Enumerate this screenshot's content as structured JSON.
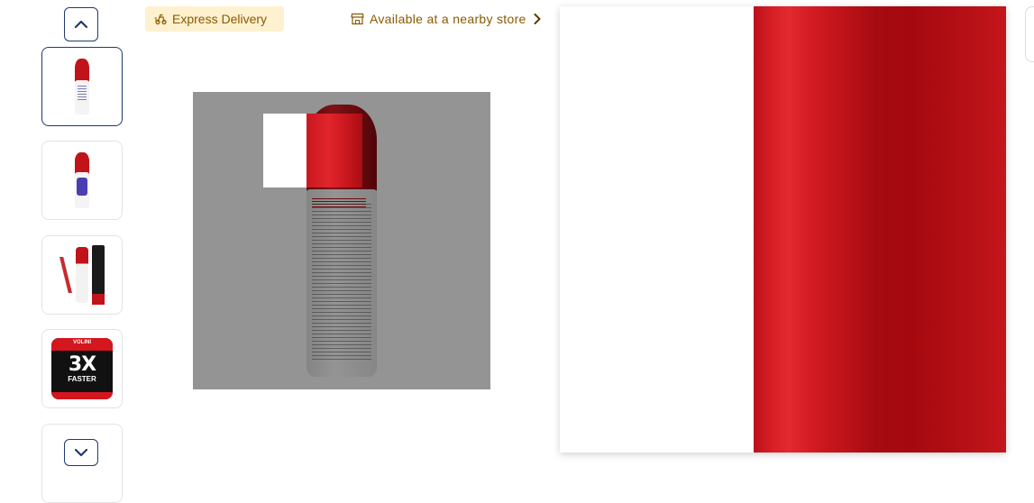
{
  "header": {
    "express_label": "Express Delivery",
    "store_label": "Available at a nearby store"
  },
  "thumbnails": {
    "up_icon": "chevron-up-icon",
    "down_icon": "chevron-down-icon",
    "items": [
      {
        "kind": "bottle-back",
        "selected": true
      },
      {
        "kind": "bottle-front",
        "selected": false
      },
      {
        "kind": "promo-bottle-and-box",
        "selected": false
      },
      {
        "kind": "promo-3x-faster",
        "selected": false,
        "brand": "VOLINI",
        "big_text": "3X",
        "sub_text": "FASTER"
      }
    ]
  },
  "colors": {
    "accent_navy": "#1e3a6e",
    "badge_bg": "#fdf1cf",
    "badge_text": "#8a5a00",
    "product_red": "#c0141a"
  }
}
